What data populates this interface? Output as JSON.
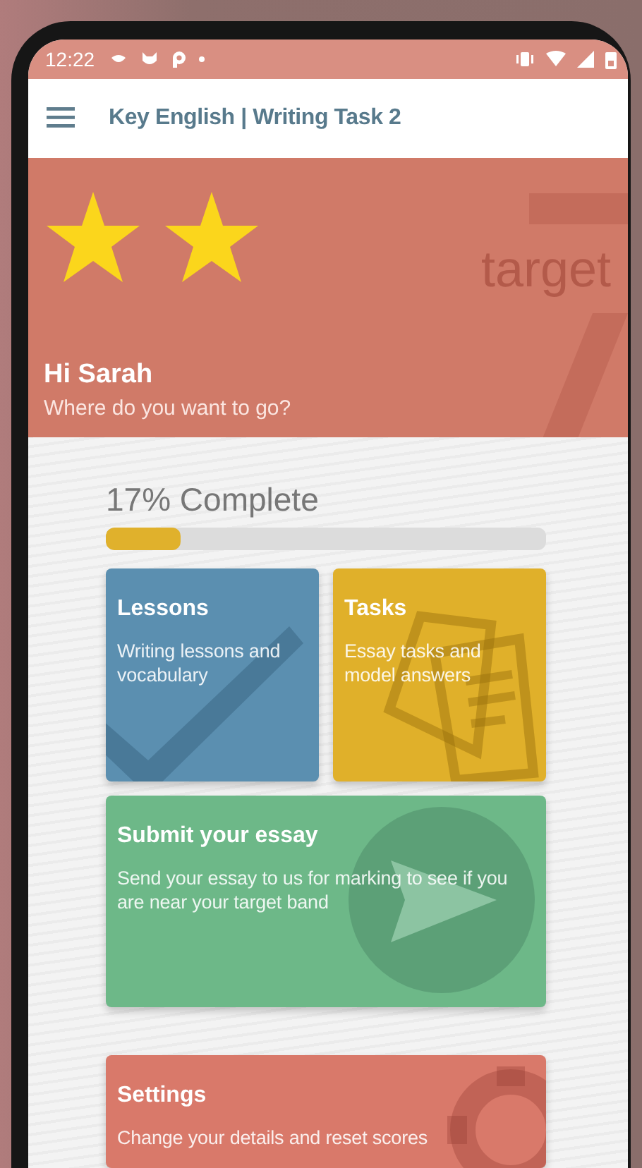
{
  "status_bar": {
    "time": "12:22"
  },
  "app_bar": {
    "title": "Key English | Writing Task 2"
  },
  "header": {
    "awards": [
      {
        "kind": "star"
      },
      {
        "kind": "star"
      }
    ],
    "backdrop_word": "target",
    "greeting": "Hi Sarah",
    "subtitle": "Where do you want to go?"
  },
  "progress": {
    "label": "17% Complete",
    "level": 0.17
  },
  "cards": [
    {
      "kind": "lessons",
      "title": "Lessons",
      "description": "Writing lessons and vocabulary",
      "color": "#5b8fb0"
    },
    {
      "kind": "tasks",
      "title": "Tasks",
      "description": "Essay tasks and model answers",
      "color": "#e0b02a"
    },
    {
      "kind": "submit",
      "title": "Submit your essay",
      "description": "Send your essay to us for marking to see if you are near your target band",
      "color": "#6db888"
    },
    {
      "kind": "settings",
      "title": "Settings",
      "description": "Change your details and reset scores",
      "color": "#d9796a"
    }
  ]
}
